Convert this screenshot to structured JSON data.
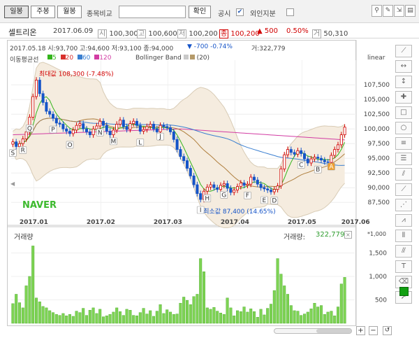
{
  "toolbar": {
    "periods": [
      "일봉",
      "주봉",
      "월봉"
    ],
    "compare_label": "종목비교",
    "confirm_label": "확인",
    "notice_label": "공시",
    "notice_checked": "✔",
    "foreign_label": "외인지분"
  },
  "stock": {
    "name": "셀트리온",
    "date": "2017.06.09",
    "fields": [
      {
        "tag": "시",
        "value": "100,300"
      },
      {
        "tag": "고",
        "value": "100,600"
      },
      {
        "tag": "저",
        "value": "100,200"
      },
      {
        "tag": "종",
        "value": "100,200"
      }
    ],
    "change": "▲ 500",
    "change_pct": "0.50%",
    "volume_tag": "거",
    "volume": "50,310",
    "color_up": "#d10000",
    "color_down": "#1554c8"
  },
  "chart_header": {
    "ohlc": "2017.05.18  시:93,700  고:94,600  저:93,100  종:94,000",
    "change": "▼  -700  -0.74%",
    "volume": "거:322,779",
    "ma_label": "이동평균선",
    "ma": [
      {
        "period": "5",
        "color": "#33b51c"
      },
      {
        "period": "20",
        "color": "#d8302d"
      },
      {
        "period": "60",
        "color": "#3a7fd0"
      },
      {
        "period": "120",
        "color": "#d23ca3"
      }
    ],
    "bollinger_label": "Bollinger Band",
    "bollinger_param": "(20)",
    "scale_mode": "linear"
  },
  "chart_data": {
    "type": "candlestick",
    "y_ticks": [
      "107,500",
      "105,000",
      "102,500",
      "100,000",
      "97,500",
      "95,000",
      "92,500",
      "90,000",
      "87,500"
    ],
    "x_ticks": [
      "2017.01",
      "2017.02",
      "2017.03",
      "2017.04",
      "2017.05",
      "2017.06"
    ],
    "ylim": [
      85500,
      110500
    ],
    "max_annotation": "최대값 108,300 (-7.48%)",
    "min_annotation": "최소값 87,400 (14.65%)",
    "close": [
      97800,
      97000,
      97500,
      98300,
      99500,
      102000,
      105500,
      108300,
      106000,
      104500,
      103000,
      102500,
      101800,
      101000,
      100800,
      100000,
      99600,
      99200,
      99800,
      100600,
      100900,
      100000,
      99500,
      99000,
      100000,
      100500,
      101300,
      100600,
      99600,
      99000,
      99800,
      100800,
      101500,
      100400,
      99900,
      100900,
      101300,
      100600,
      99600,
      99900,
      100400,
      100800,
      100000,
      99500,
      100600,
      100400,
      100200,
      99500,
      98200,
      96500,
      95300,
      94600,
      93300,
      92000,
      90500,
      89000,
      88000,
      89400,
      90100,
      90500,
      90000,
      89700,
      90400,
      90700,
      89900,
      89200,
      89600,
      90200,
      90800,
      90400,
      90600,
      91800,
      91300,
      90600,
      90000,
      89800,
      89600,
      89300,
      89700,
      90300,
      93200,
      95600,
      96500,
      96000,
      95700,
      96300,
      95800,
      94900,
      94200,
      94900,
      95200,
      95000,
      94700,
      94400,
      94300,
      95500,
      96500,
      97300,
      99000,
      100300
    ],
    "sample_candles": [
      {
        "o": 93700,
        "h": 94600,
        "l": 93100,
        "c": 94000
      }
    ],
    "volume_ticks": [
      "1,500",
      "1,000",
      "500"
    ],
    "volume_unit": "*1,000",
    "volume": [
      420,
      620,
      440,
      330,
      800,
      1000,
      1650,
      540,
      460,
      360,
      330,
      270,
      230,
      190,
      170,
      210,
      160,
      190,
      150,
      260,
      230,
      320,
      170,
      280,
      330,
      210,
      300,
      140,
      160,
      190,
      240,
      330,
      250,
      170,
      300,
      280,
      170,
      160,
      230,
      320,
      200,
      270,
      150,
      260,
      400,
      210,
      290,
      240,
      190,
      200,
      430,
      560,
      490,
      400,
      570,
      620,
      1380,
      1100,
      330,
      300,
      340,
      260,
      220,
      190,
      540,
      330,
      160,
      270,
      250,
      350,
      240,
      310,
      250,
      130,
      300,
      180,
      320,
      410,
      700,
      1380,
      1050,
      800,
      620,
      380,
      270,
      260,
      170,
      200,
      240,
      310,
      430,
      350,
      380,
      190,
      240,
      260,
      160,
      350,
      840,
      980
    ],
    "volume_ylim": [
      0,
      1850
    ]
  },
  "volume_panel": {
    "title": "거래량",
    "readout_label": "거래량:",
    "readout_value": "322,779"
  },
  "markers": [
    {
      "label": "S",
      "i": 0
    },
    {
      "label": "R",
      "i": 3
    },
    {
      "label": "Q",
      "i": 5
    },
    {
      "label": "P",
      "i": 12
    },
    {
      "label": "O",
      "i": 17
    },
    {
      "label": "N",
      "i": 26
    },
    {
      "label": "M",
      "i": 30
    },
    {
      "label": "L",
      "i": 38
    },
    {
      "label": "J",
      "i": 44
    },
    {
      "label": "I",
      "i": 56
    },
    {
      "label": "H",
      "i": 58
    },
    {
      "label": "G",
      "i": 63
    },
    {
      "label": "F",
      "i": 70
    },
    {
      "label": "E",
      "i": 75
    },
    {
      "label": "D",
      "i": 78
    },
    {
      "label": "C",
      "i": 86
    },
    {
      "label": "B",
      "i": 91
    },
    {
      "label": "A",
      "i": 95
    }
  ],
  "watermark": "NAVER",
  "scroll": {
    "plus": "+",
    "minus": "−",
    "reset": "↺"
  }
}
